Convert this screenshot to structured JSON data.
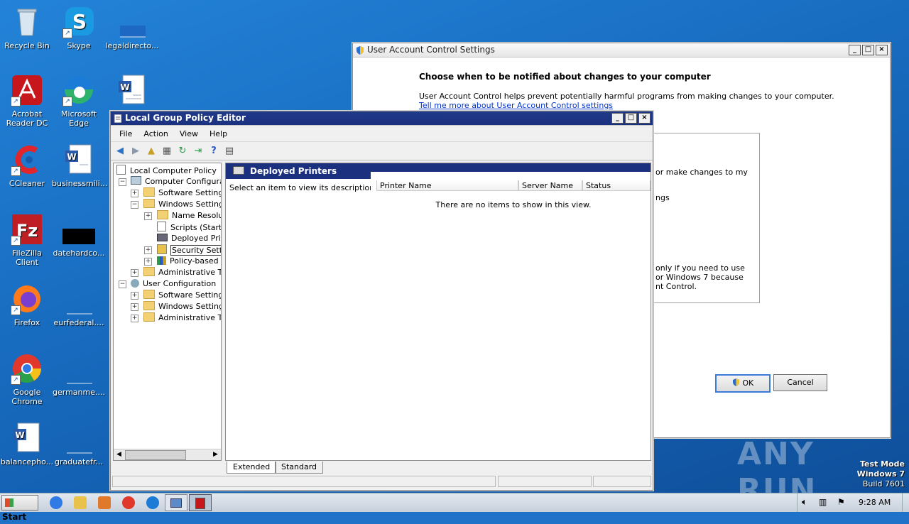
{
  "desktop": {
    "icons": [
      {
        "label": "Recycle Bin"
      },
      {
        "label": "Skype"
      },
      {
        "label": "legaldirecto..."
      },
      {
        "label": "Acrobat Reader DC"
      },
      {
        "label": "Microsoft Edge"
      },
      {
        "label": "CCleaner"
      },
      {
        "label": "businessmili..."
      },
      {
        "label": "FileZilla Client"
      },
      {
        "label": "datehardco..."
      },
      {
        "label": "Firefox"
      },
      {
        "label": "eurfederal...."
      },
      {
        "label": "Google Chrome"
      },
      {
        "label": "germanme...."
      },
      {
        "label": "balancepho..."
      },
      {
        "label": "graduatefr..."
      }
    ],
    "watermark": {
      "brand": "ANY RUN",
      "mode": "Test Mode",
      "os": "Windows 7",
      "build": "Build 7601"
    }
  },
  "uac": {
    "title": "User Account Control Settings",
    "heading": "Choose when to be notified about changes to your computer",
    "description": "User Account Control helps prevent potentially harmful programs from making changes to your computer.",
    "link": "Tell me more about User Account Control settings",
    "partial_text_1": "or make changes to my",
    "partial_text_2": "ngs",
    "partial_text_3": "only if you need to use",
    "partial_text_4": "or Windows 7 because",
    "partial_text_5": "nt Control.",
    "ok_label": "OK",
    "cancel_label": "Cancel"
  },
  "gpedit": {
    "title": "Local Group Policy Editor",
    "menu": [
      "File",
      "Action",
      "View",
      "Help"
    ],
    "tree": [
      {
        "label": "Local Computer Policy"
      },
      {
        "label": "Computer Configuratio"
      },
      {
        "label": "Software Settings"
      },
      {
        "label": "Windows Settings"
      },
      {
        "label": "Name Resolutic"
      },
      {
        "label": "Scripts (Startup"
      },
      {
        "label": "Deployed Printe"
      },
      {
        "label": "Security Settings"
      },
      {
        "label": "Policy-based Q"
      },
      {
        "label": "Administrative Tem"
      },
      {
        "label": "User Configuration"
      },
      {
        "label": "Software Settings"
      },
      {
        "label": "Windows Settings"
      },
      {
        "label": "Administrative Tem"
      }
    ],
    "panel_title": "Deployed Printers",
    "description": "Select an item to view its description.",
    "columns": [
      "Printer Name",
      "Server Name",
      "Status"
    ],
    "empty_message": "There are no items to show in this view.",
    "tabs": [
      "Extended",
      "Standard"
    ]
  },
  "taskbar": {
    "start_label": "Start",
    "clock": "9:28 AM"
  }
}
